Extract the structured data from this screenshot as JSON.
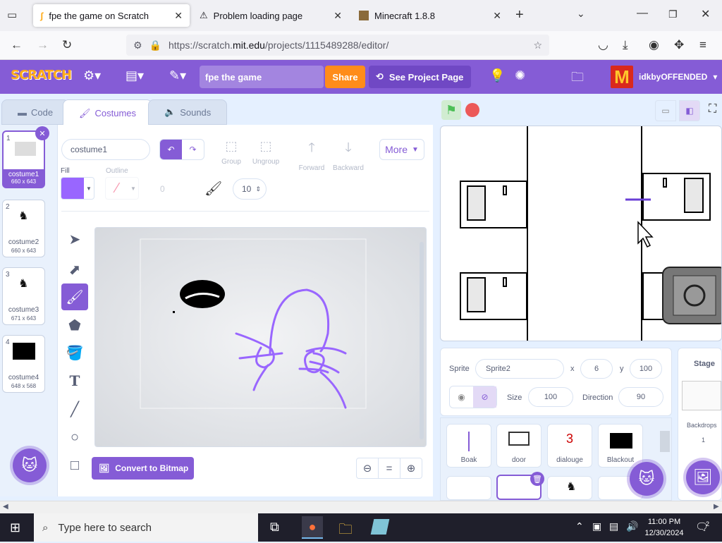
{
  "browser": {
    "tabs": [
      {
        "label": "fpe the game on Scratch",
        "active": true
      },
      {
        "label": "Problem loading page",
        "active": false
      },
      {
        "label": "Minecraft 1.8.8",
        "active": false
      }
    ],
    "url_prefix": "https://scratch.",
    "url_host": "mit.edu",
    "url_path": "/projects/1115489288/editor/"
  },
  "menubar": {
    "logo": "SCRATCH",
    "project_title": "fpe the game",
    "share_label": "Share",
    "see_project_label": "See Project Page",
    "username": "idkbyOFFENDED",
    "avatar_letter": "M"
  },
  "editor_tabs": {
    "code": "Code",
    "costumes": "Costumes",
    "sounds": "Sounds"
  },
  "costumes": [
    {
      "num": "1",
      "name": "costume1",
      "dim": "660 x 643",
      "selected": true
    },
    {
      "num": "2",
      "name": "costume2",
      "dim": "660 x 643",
      "selected": false
    },
    {
      "num": "3",
      "name": "costume3",
      "dim": "671 x 643",
      "selected": false
    },
    {
      "num": "4",
      "name": "costume4",
      "dim": "648 x 568",
      "selected": false
    }
  ],
  "paint": {
    "costume_name": "costume1",
    "fill_label": "Fill",
    "outline_label": "Outline",
    "outline_width": "0",
    "brush_size": "10",
    "fill_color": "#9966ff",
    "group_label": "Group",
    "ungroup_label": "Ungroup",
    "forward_label": "Forward",
    "backward_label": "Backward",
    "more_label": "More",
    "convert_label": "Convert to Bitmap"
  },
  "sprite": {
    "sprite_label": "Sprite",
    "name": "Sprite2",
    "x_label": "x",
    "x": "6",
    "y_label": "y",
    "y": "100",
    "size_label": "Size",
    "size": "100",
    "direction_label": "Direction",
    "direction": "90"
  },
  "sprite_tiles": [
    {
      "name": "Boak"
    },
    {
      "name": "door"
    },
    {
      "name": "dialouge",
      "glyph": "3"
    },
    {
      "name": "Blackout"
    }
  ],
  "stage_panel": {
    "title": "Stage",
    "backdrops_label": "Backdrops",
    "backdrops_count": "1"
  },
  "taskbar": {
    "search_placeholder": "Type here to search",
    "time": "11:00 PM",
    "date": "12/30/2024",
    "notifications": "2"
  },
  "colors": {
    "scratch_purple": "#855cd6",
    "share_orange": "#ff8c1a",
    "brush_purple": "#9966ff"
  }
}
